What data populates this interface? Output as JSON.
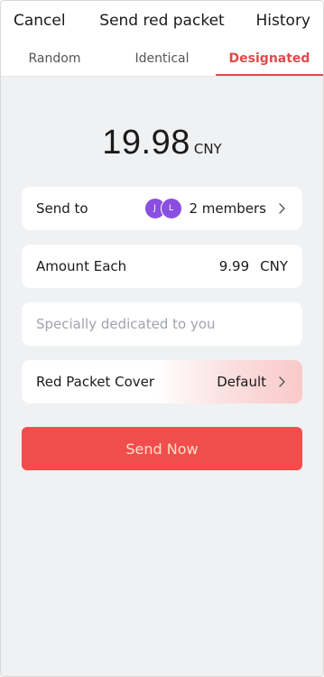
{
  "header": {
    "cancel_label": "Cancel",
    "title": "Send red packet",
    "history_label": "History"
  },
  "tabs": [
    {
      "label": "Random",
      "active": false
    },
    {
      "label": "Identical",
      "active": false
    },
    {
      "label": "Designated",
      "active": true
    }
  ],
  "total": {
    "value": "19.98",
    "currency": "CNY"
  },
  "send_to": {
    "label": "Send to",
    "avatars": [
      "J",
      "L"
    ],
    "value": "2 members",
    "icon": "chevron-right-icon"
  },
  "amount_each": {
    "label": "Amount Each",
    "value": "9.99",
    "currency": "CNY"
  },
  "message": {
    "placeholder": "Specially dedicated to you"
  },
  "cover": {
    "label": "Red Packet Cover",
    "value": "Default",
    "icon": "chevron-right-icon"
  },
  "send_button": {
    "label": "Send Now"
  },
  "colors": {
    "accent": "#e04a4a",
    "button": "#f24d4d",
    "button_text": "#fde2c8",
    "avatar": "#8a4fe0",
    "background": "#f0f1f3"
  }
}
